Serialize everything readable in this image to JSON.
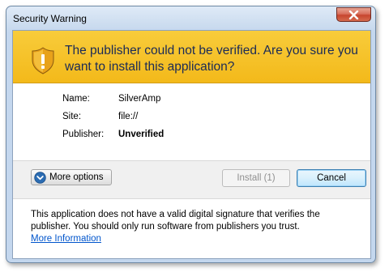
{
  "window": {
    "title": "Security Warning"
  },
  "banner": {
    "headline": "The publisher could not be verified. Are you sure you want to install this application?",
    "icon": "shield-warning-icon"
  },
  "details": {
    "name_label": "Name:",
    "name_value": "SilverAmp",
    "site_label": "Site:",
    "site_value": "file://",
    "publisher_label": "Publisher:",
    "publisher_value": "Unverified"
  },
  "actions": {
    "more_options_label": "More options",
    "install_label": "Install (1)",
    "cancel_label": "Cancel"
  },
  "footer": {
    "message": "This application does not have a valid digital signature that verifies the publisher. You should only run software from publishers you trust.",
    "link_label": "More Information"
  },
  "colors": {
    "banner": "#f3b91a",
    "headline_text": "#1a2a57",
    "link": "#0055cc",
    "close_button": "#c7452f"
  }
}
